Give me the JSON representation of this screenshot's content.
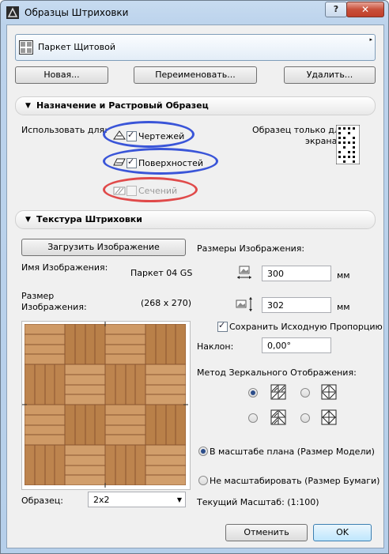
{
  "window": {
    "title": "Образцы Штриховки",
    "help_label": "?",
    "close_label": "✕"
  },
  "pattern_selector": {
    "name": "Паркет Щитовой",
    "arrow": "▸"
  },
  "buttons": {
    "new": "Новая...",
    "rename": "Переименовать...",
    "delete": "Удалить..."
  },
  "section1": {
    "title": "Назначение и Растровый Образец",
    "use_for_label": "Использовать для:",
    "drawings_label": "Чертежей",
    "surfaces_label": "Поверхностей",
    "sections_label": "Сечений",
    "screen_sample_line1": "Образец только для",
    "screen_sample_line2": "экрана:"
  },
  "section2": {
    "title": "Текстура Штриховки",
    "load_image_label": "Загрузить Изображение",
    "image_name_label": "Имя Изображения:",
    "image_name_value": "Паркет 04 GS",
    "image_size_label_1": "Размер",
    "image_size_label_2": "Изображения:",
    "image_size_value": "(268 x 270)",
    "sample_label": "Образец:",
    "sample_value": "2x2",
    "sizes_title": "Размеры Изображения:",
    "width_value": "300",
    "height_value": "302",
    "unit": "мм",
    "keep_ratio_label": "Сохранить Исходную Пропорцию",
    "tilt_label": "Наклон:",
    "tilt_value": "0,00°",
    "mirror_title": "Метод Зеркального Отображения:",
    "scale_plan_label": "В масштабе плана (Размер Модели)",
    "no_scale_label": "Не масштабировать (Размер Бумаги)",
    "current_scale_label": "Текущий Масштаб:  (1:100)"
  },
  "footer": {
    "cancel": "Отменить",
    "ok": "OK"
  },
  "colors": {
    "blue_ring": "#3a55d8",
    "red_ring": "#e04a4a",
    "wood_light": "#c8935c",
    "wood_dark": "#9c6336"
  }
}
